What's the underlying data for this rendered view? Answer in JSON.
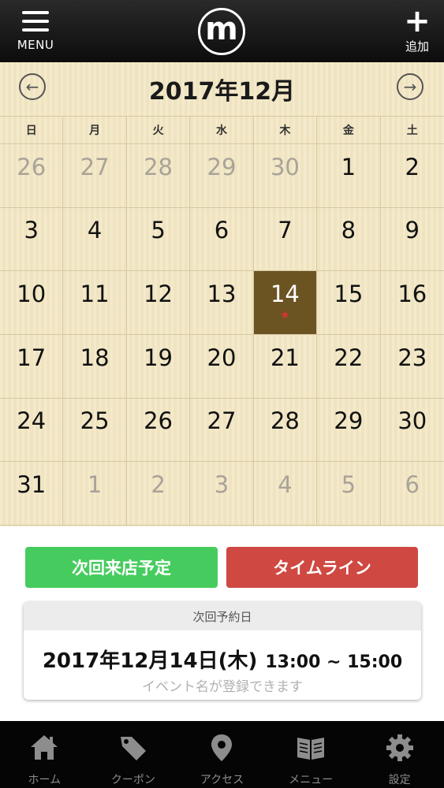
{
  "header": {
    "menu_label": "MENU",
    "logo_letter": "m",
    "add_label": "追加"
  },
  "calendar": {
    "title": "2017年12月",
    "weekdays": [
      "日",
      "月",
      "火",
      "水",
      "木",
      "金",
      "土"
    ],
    "days": [
      {
        "d": "26",
        "muted": true
      },
      {
        "d": "27",
        "muted": true
      },
      {
        "d": "28",
        "muted": true
      },
      {
        "d": "29",
        "muted": true
      },
      {
        "d": "30",
        "muted": true
      },
      {
        "d": "1"
      },
      {
        "d": "2"
      },
      {
        "d": "3"
      },
      {
        "d": "4"
      },
      {
        "d": "5"
      },
      {
        "d": "6"
      },
      {
        "d": "7"
      },
      {
        "d": "8"
      },
      {
        "d": "9"
      },
      {
        "d": "10"
      },
      {
        "d": "11"
      },
      {
        "d": "12"
      },
      {
        "d": "13"
      },
      {
        "d": "14",
        "selected": true,
        "star": true
      },
      {
        "d": "15"
      },
      {
        "d": "16"
      },
      {
        "d": "17"
      },
      {
        "d": "18"
      },
      {
        "d": "19"
      },
      {
        "d": "20"
      },
      {
        "d": "21"
      },
      {
        "d": "22"
      },
      {
        "d": "23"
      },
      {
        "d": "24"
      },
      {
        "d": "25"
      },
      {
        "d": "26"
      },
      {
        "d": "27"
      },
      {
        "d": "28"
      },
      {
        "d": "29"
      },
      {
        "d": "30"
      },
      {
        "d": "31"
      },
      {
        "d": "1",
        "muted": true
      },
      {
        "d": "2",
        "muted": true
      },
      {
        "d": "3",
        "muted": true
      },
      {
        "d": "4",
        "muted": true
      },
      {
        "d": "5",
        "muted": true
      },
      {
        "d": "6",
        "muted": true
      }
    ],
    "star_glyph": "★"
  },
  "buttons": {
    "next_visit": "次回来店予定",
    "timeline": "タイムライン"
  },
  "reservation": {
    "heading": "次回予約日",
    "date": "2017年12月14日(木)",
    "time": "13:00 ~ 15:00",
    "note": "イベント名が登録できます"
  },
  "tabs": [
    {
      "label": "ホーム",
      "icon": "home-icon"
    },
    {
      "label": "クーポン",
      "icon": "tag-icon"
    },
    {
      "label": "アクセス",
      "icon": "map-pin-icon"
    },
    {
      "label": "メニュー",
      "icon": "book-icon"
    },
    {
      "label": "設定",
      "icon": "gear-icon"
    }
  ],
  "colors": {
    "calendar_bg": "#f3e7c4",
    "selected_day": "#6b5322",
    "next_visit_button": "#46cc5e",
    "timeline_button": "#cf4842"
  }
}
